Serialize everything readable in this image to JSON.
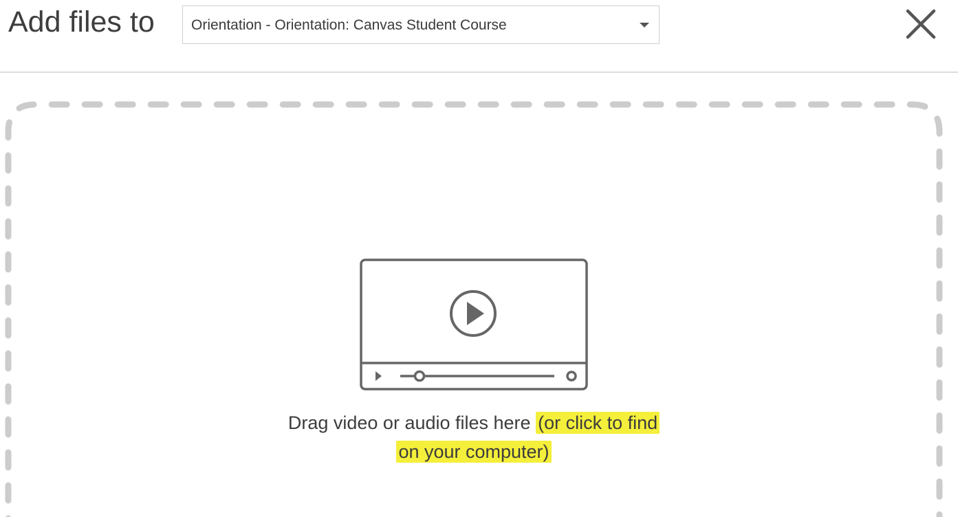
{
  "dialog": {
    "title": "Add files to",
    "close_label": "close"
  },
  "destination_select": {
    "selected": "Orientation - Orientation: Canvas Student Course"
  },
  "dropzone": {
    "text_plain": "Drag video or audio files here",
    "text_link_line1": "(or click to find",
    "text_link_line2": "on your computer)",
    "icon": "video-player-icon",
    "highlight_color": "#f4ef3a"
  },
  "colors": {
    "dashed_border": "#cccccc",
    "icon_stroke": "#666666",
    "header_divider": "#dcdcdc"
  }
}
